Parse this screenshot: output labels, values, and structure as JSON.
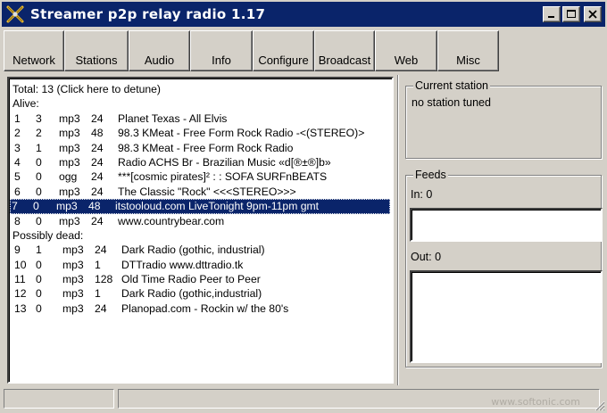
{
  "window": {
    "title": "Streamer p2p relay radio 1.17",
    "icon": "antenna-x-icon"
  },
  "toolbar": {
    "buttons": [
      {
        "label": "Network"
      },
      {
        "label": "Stations"
      },
      {
        "label": "Audio"
      },
      {
        "label": "Info"
      },
      {
        "label": "Configure"
      },
      {
        "label": "Broadcast"
      },
      {
        "label": "Web"
      },
      {
        "label": "Misc"
      }
    ]
  },
  "station_list": {
    "total_line": "Total: 13  (Click here to detune)",
    "alive_header": "Alive:",
    "dead_header": "Possibly dead:",
    "alive": [
      {
        "num": "1",
        "a": "3",
        "fmt": "mp3",
        "br": "24",
        "name": "Planet Texas - All Elvis"
      },
      {
        "num": "2",
        "a": "2",
        "fmt": "mp3",
        "br": "48",
        "name": "98.3 KMeat - Free Form Rock Radio -<(STEREO)>"
      },
      {
        "num": "3",
        "a": "1",
        "fmt": "mp3",
        "br": "24",
        "name": "98.3 KMeat - Free Form Rock Radio"
      },
      {
        "num": "4",
        "a": "0",
        "fmt": "mp3",
        "br": "24",
        "name": "Radio ACHS Br - Brazilian Music «d[®±®]b»"
      },
      {
        "num": "5",
        "a": "0",
        "fmt": "ogg",
        "br": "24",
        "name": "***[cosmic pirates]² : : SOFA SURFnBEATS"
      },
      {
        "num": "6",
        "a": "0",
        "fmt": "mp3",
        "br": "24",
        "name": "The Classic \"Rock\" <<<STEREO>>>"
      },
      {
        "num": "7",
        "a": "0",
        "fmt": "mp3",
        "br": "48",
        "name": "itstooloud.com LiveTonight 9pm-11pm gmt",
        "selected": true
      },
      {
        "num": "8",
        "a": "0",
        "fmt": "mp3",
        "br": "24",
        "name": "www.countrybear.com"
      }
    ],
    "dead": [
      {
        "num": "9",
        "a": "1",
        "fmt": "mp3",
        "br": "24",
        "name": "Dark Radio (gothic, industrial)"
      },
      {
        "num": "10",
        "a": "0",
        "fmt": "mp3",
        "br": "1",
        "name": "DTTradio www.dttradio.tk"
      },
      {
        "num": "11",
        "a": "0",
        "fmt": "mp3",
        "br": "128",
        "name": "Old Time Radio Peer to Peer"
      },
      {
        "num": "12",
        "a": "0",
        "fmt": "mp3",
        "br": "1",
        "name": "Dark Radio (gothic,industrial)"
      },
      {
        "num": "13",
        "a": "0",
        "fmt": "mp3",
        "br": "24",
        "name": "Planopad.com - Rockin w/ the 80's"
      }
    ]
  },
  "current_station": {
    "label": "Current station",
    "value": "no station tuned"
  },
  "feeds": {
    "label": "Feeds",
    "in_label": "In: 0",
    "out_label": "Out: 0"
  },
  "watermark": "www.softonic.com",
  "colors": {
    "titlebar": "#0a246a",
    "face": "#d4d0c8",
    "selection": "#0a246a"
  }
}
